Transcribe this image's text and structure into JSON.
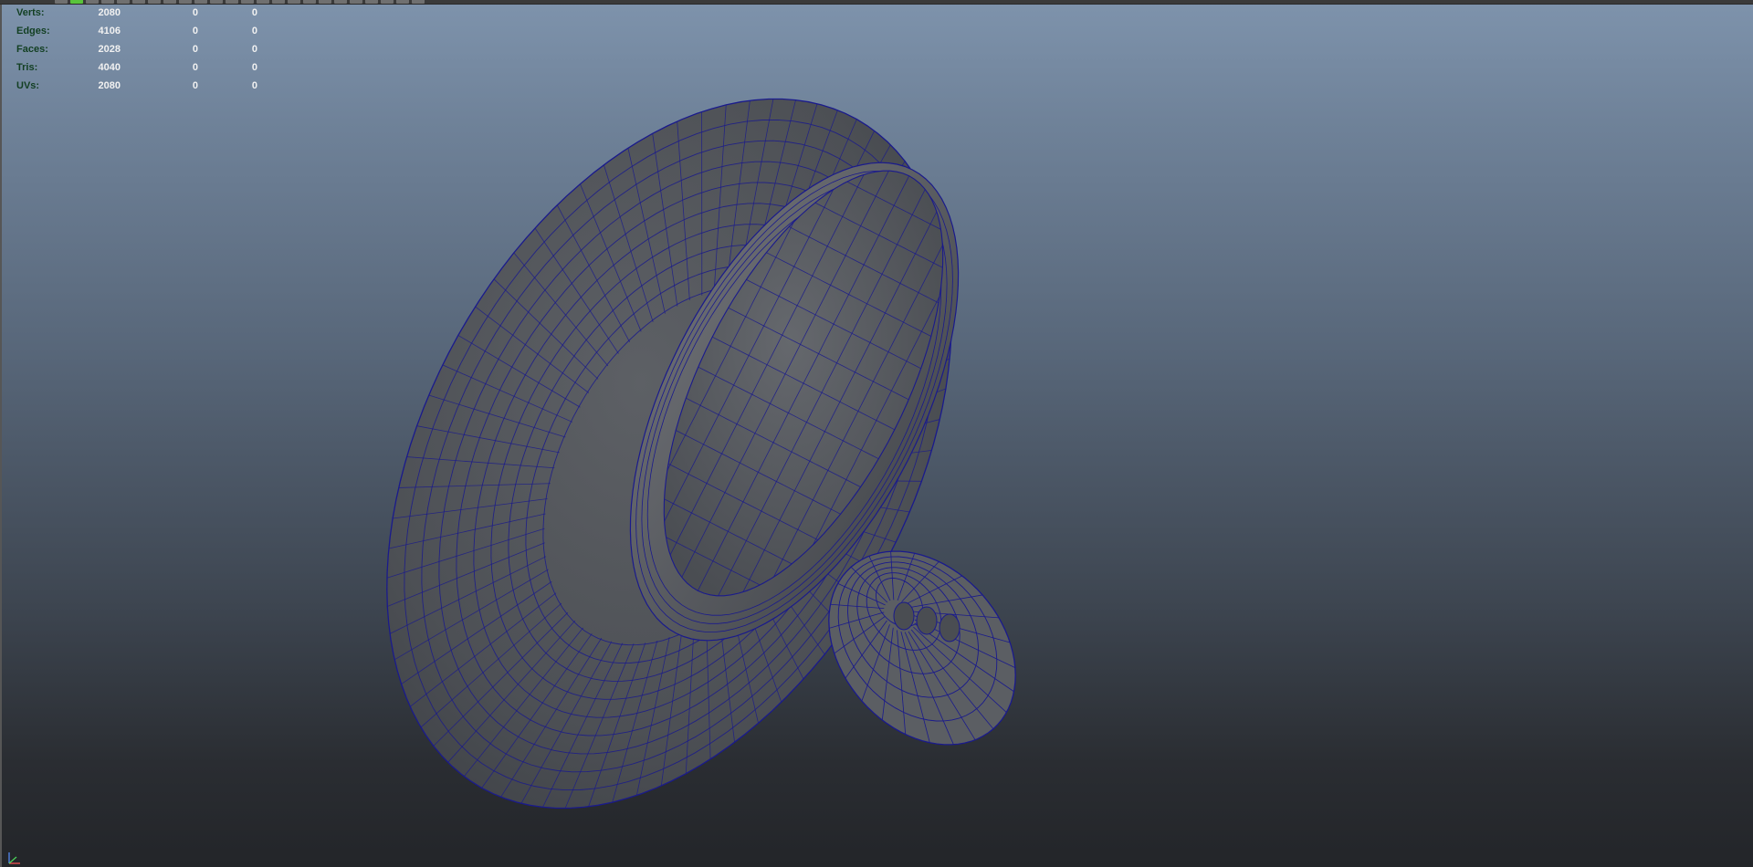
{
  "hud": {
    "rows": [
      {
        "label": "Verts:",
        "v1": "2080",
        "v2": "0",
        "v3": "0"
      },
      {
        "label": "Edges:",
        "v1": "4106",
        "v2": "0",
        "v3": "0"
      },
      {
        "label": "Faces:",
        "v1": "2028",
        "v2": "0",
        "v3": "0"
      },
      {
        "label": "Tris:",
        "v1": "4040",
        "v2": "0",
        "v3": "0"
      },
      {
        "label": "UVs:",
        "v1": "2080",
        "v2": "0",
        "v3": "0"
      }
    ]
  },
  "colors": {
    "wireframe": "#1a1a8c",
    "mesh_fill": "#55585d",
    "hud_label": "#123f22",
    "hud_value": "#f1f1f1",
    "toolbar_active": "#59c43b"
  },
  "icons": {
    "axis": "view-axis-icon"
  }
}
